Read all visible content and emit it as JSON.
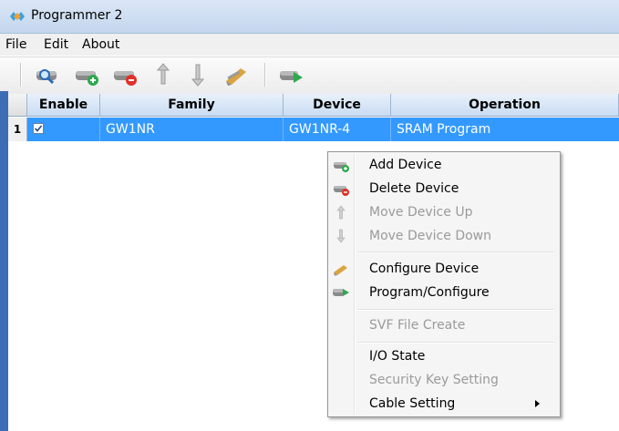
{
  "window": {
    "title": "Programmer 2"
  },
  "menu": {
    "file": "File",
    "edit": "Edit",
    "about": "About"
  },
  "toolbar": {
    "icons": [
      "scan-device-icon",
      "add-device-icon",
      "delete-device-icon",
      "move-up-icon",
      "move-down-icon",
      "configure-device-icon",
      "program-configure-icon"
    ]
  },
  "table": {
    "headers": {
      "enable": "Enable",
      "family": "Family",
      "device": "Device",
      "operation": "Operation"
    },
    "rows": [
      {
        "num": "1",
        "enabled": true,
        "family": "GW1NR",
        "device": "GW1NR-4",
        "operation": "SRAM Program"
      }
    ]
  },
  "context_menu": {
    "add_device": "Add Device",
    "delete_device": "Delete Device",
    "move_up": "Move Device Up",
    "move_down": "Move Device Down",
    "configure_device": "Configure Device",
    "program_configure": "Program/Configure",
    "svf_file_create": "SVF File Create",
    "io_state": "I/O State",
    "security_key_setting": "Security Key Setting",
    "cable_setting": "Cable Setting"
  },
  "colors": {
    "selection": "#3399ff",
    "accent_strip": "#3d6db5"
  }
}
